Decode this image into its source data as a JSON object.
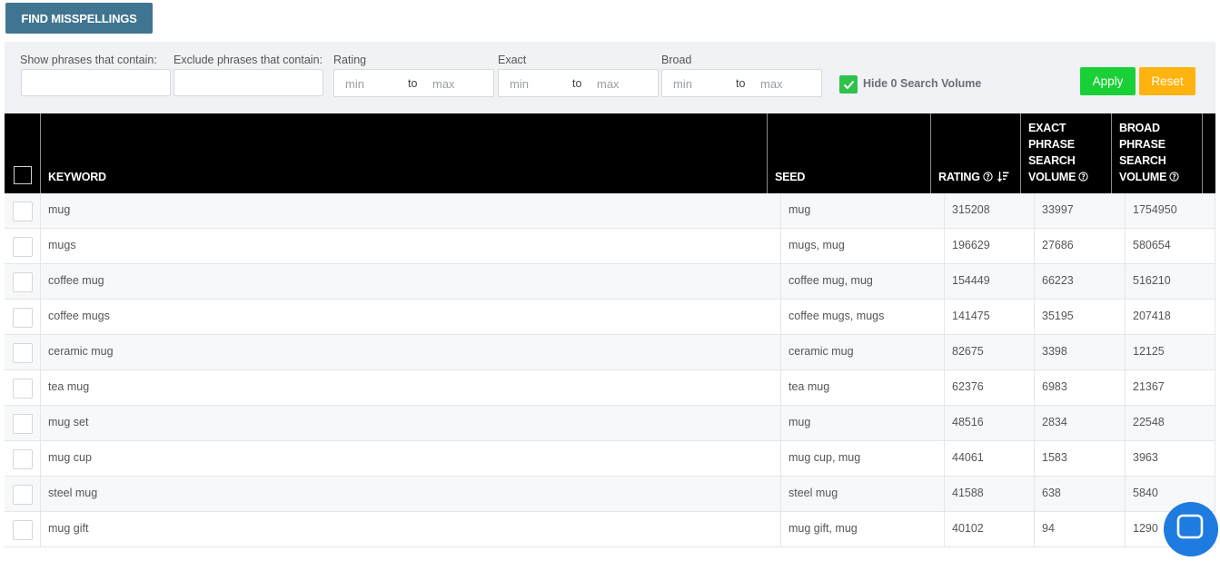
{
  "toolbar": {
    "find_misspellings_label": "FIND MISSPELLINGS"
  },
  "filters": {
    "show_phrases_label": "Show phrases that contain:",
    "exclude_phrases_label": "Exclude phrases that contain:",
    "rating_label": "Rating",
    "exact_label": "Exact",
    "broad_label": "Broad",
    "min_placeholder": "min",
    "max_placeholder": "max",
    "to_label": "to",
    "hide_zero_label": "Hide 0 Search Volume",
    "hide_zero_checked": true,
    "apply_label": "Apply",
    "reset_label": "Reset",
    "accent_green": "#19d136",
    "accent_orange": "#ffb30f"
  },
  "table": {
    "headers": {
      "keyword": "KEYWORD",
      "seed": "SEED",
      "rating": "RATING",
      "exact": "EXACT\nPHRASE\nSEARCH\nVOLUME",
      "broad": "BROAD\nPHRASE\nSEARCH\nVOLUME"
    },
    "rows": [
      {
        "keyword": "mug",
        "seed": "mug",
        "rating": "315208",
        "exact": "33997",
        "broad": "1754950"
      },
      {
        "keyword": "mugs",
        "seed": "mugs, mug",
        "rating": "196629",
        "exact": "27686",
        "broad": "580654"
      },
      {
        "keyword": "coffee mug",
        "seed": "coffee mug, mug",
        "rating": "154449",
        "exact": "66223",
        "broad": "516210"
      },
      {
        "keyword": "coffee mugs",
        "seed": "coffee mugs, mugs",
        "rating": "141475",
        "exact": "35195",
        "broad": "207418"
      },
      {
        "keyword": "ceramic mug",
        "seed": "ceramic mug",
        "rating": "82675",
        "exact": "3398",
        "broad": "12125"
      },
      {
        "keyword": "tea mug",
        "seed": "tea mug",
        "rating": "62376",
        "exact": "6983",
        "broad": "21367"
      },
      {
        "keyword": "mug set",
        "seed": "mug",
        "rating": "48516",
        "exact": "2834",
        "broad": "22548"
      },
      {
        "keyword": "mug cup",
        "seed": "mug cup, mug",
        "rating": "44061",
        "exact": "1583",
        "broad": "3963"
      },
      {
        "keyword": "steel mug",
        "seed": "steel mug",
        "rating": "41588",
        "exact": "638",
        "broad": "5840"
      },
      {
        "keyword": "mug gift",
        "seed": "mug gift, mug",
        "rating": "40102",
        "exact": "94",
        "broad": "1290"
      }
    ]
  },
  "chat": {
    "icon": "chat-icon"
  }
}
